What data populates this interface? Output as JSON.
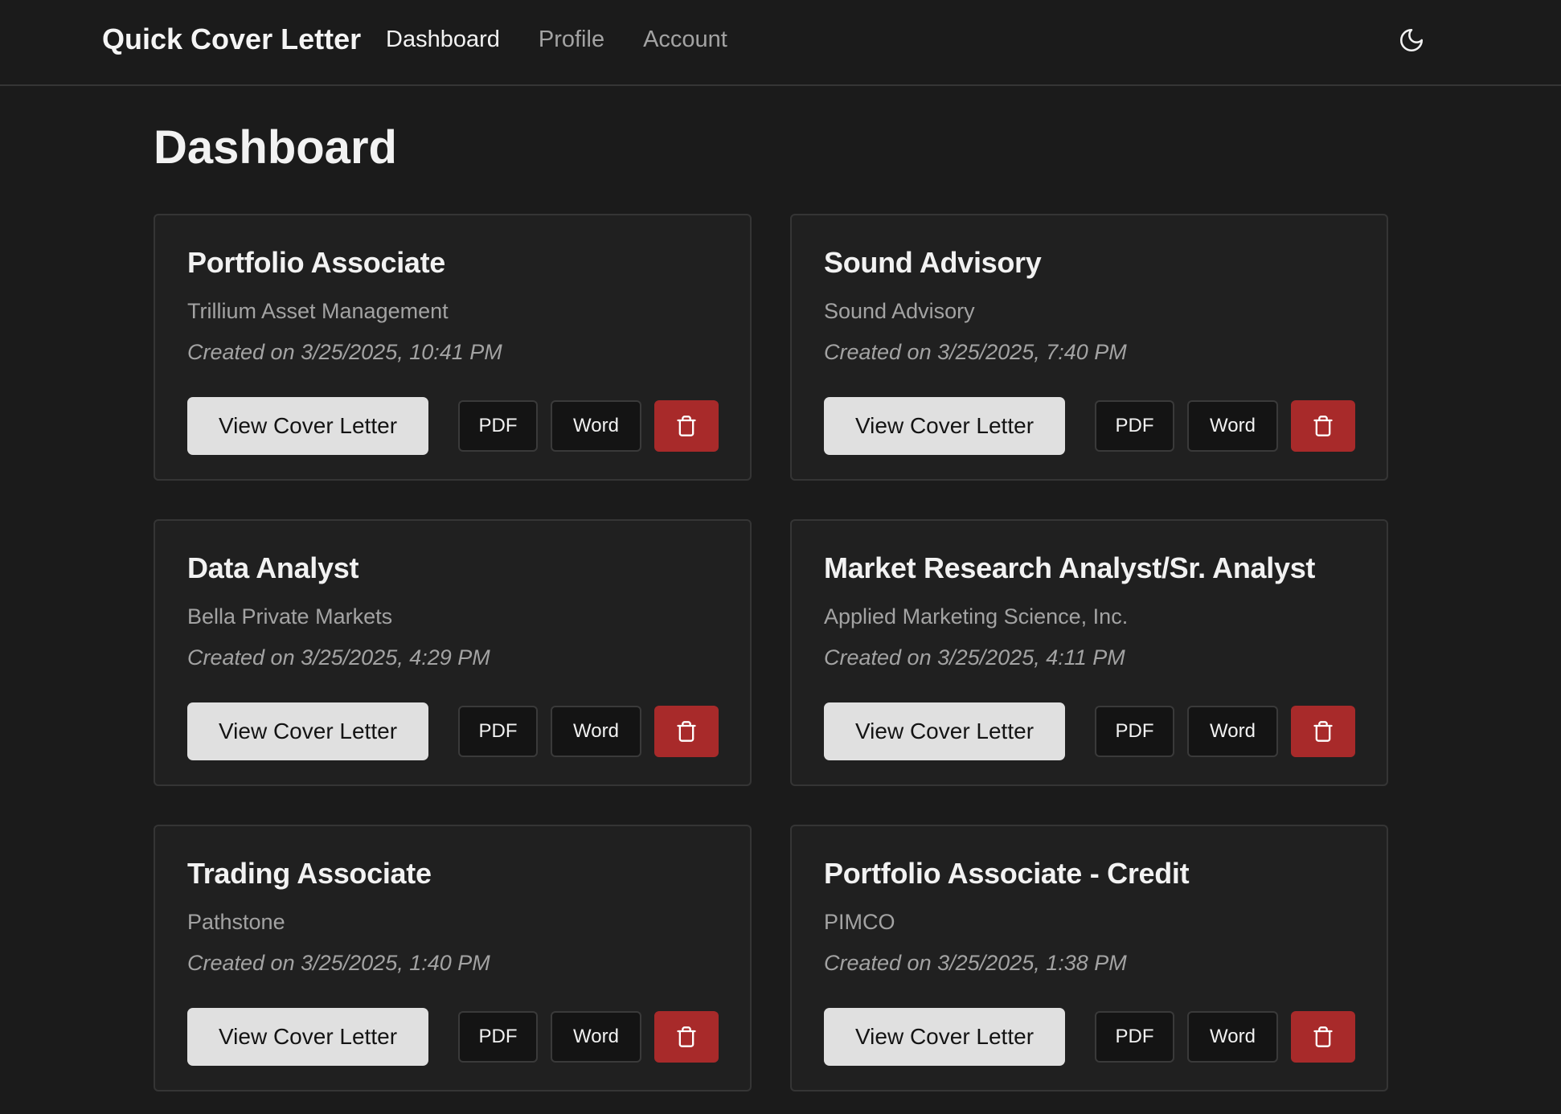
{
  "nav": {
    "brand": "Quick Cover Letter",
    "links": [
      {
        "label": "Dashboard",
        "active": true
      },
      {
        "label": "Profile",
        "active": false
      },
      {
        "label": "Account",
        "active": false
      }
    ],
    "theme_icon": "moon-icon"
  },
  "page": {
    "title": "Dashboard"
  },
  "buttons": {
    "view": "View Cover Letter",
    "pdf": "PDF",
    "word": "Word",
    "delete_icon": "trash-icon"
  },
  "colors": {
    "background": "#1b1b1b",
    "card": "#202020",
    "delete": "#a82a2a",
    "view_button": "#e0e0e0"
  },
  "cards": [
    {
      "title": "Portfolio Associate",
      "company": "Trillium Asset Management",
      "created": "Created on 3/25/2025, 10:41 PM"
    },
    {
      "title": "Sound Advisory",
      "company": "Sound Advisory",
      "created": "Created on 3/25/2025, 7:40 PM"
    },
    {
      "title": "Data Analyst",
      "company": "Bella Private Markets",
      "created": "Created on 3/25/2025, 4:29 PM"
    },
    {
      "title": "Market Research Analyst/Sr. Analyst",
      "company": "Applied Marketing Science, Inc.",
      "created": "Created on 3/25/2025, 4:11 PM"
    },
    {
      "title": "Trading Associate",
      "company": "Pathstone",
      "created": "Created on 3/25/2025, 1:40 PM"
    },
    {
      "title": "Portfolio Associate - Credit",
      "company": "PIMCO",
      "created": "Created on 3/25/2025, 1:38 PM"
    }
  ]
}
